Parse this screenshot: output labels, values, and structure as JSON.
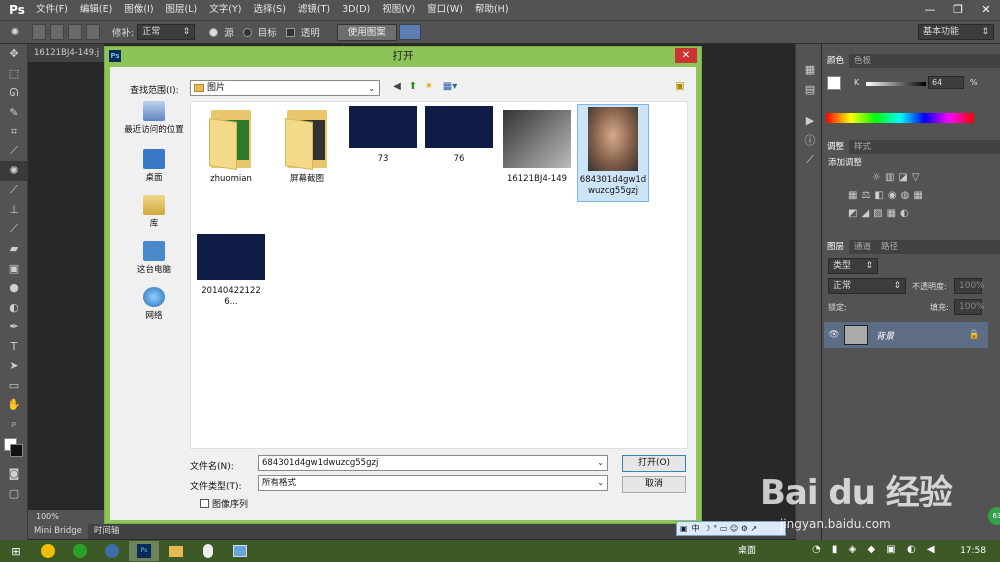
{
  "app": {
    "logo": "Ps"
  },
  "menubar": [
    "文件(F)",
    "编辑(E)",
    "图像(I)",
    "图层(L)",
    "文字(Y)",
    "选择(S)",
    "滤镜(T)",
    "3D(D)",
    "视图(V)",
    "窗口(W)",
    "帮助(H)"
  ],
  "options": {
    "feather_label": "修补:",
    "mode_value": "正常",
    "source_label": "源",
    "target_label": "目标",
    "transparent_label": "透明",
    "use_pattern_label": "使用图案",
    "workspace_value": "基本功能"
  },
  "document": {
    "tab_title": "16121BJ4-149.j",
    "zoom": "100%"
  },
  "bottom_tabs": [
    "Mini Bridge",
    "时间轴"
  ],
  "right_panel": {
    "color_tabs": [
      "颜色",
      "色板"
    ],
    "k_label": "K",
    "k_value": "64",
    "k_unit": "%",
    "adjust_tabs": [
      "调整",
      "样式"
    ],
    "add_adjustment": "添加调整",
    "layer_tabs": [
      "图层",
      "通道",
      "路径"
    ],
    "kind_label": "类型",
    "blend_mode": "正常",
    "opacity_label": "不透明度:",
    "opacity_value": "100%",
    "lock_label": "锁定:",
    "fill_label": "填充:",
    "fill_value": "100%",
    "layer_name": "背景"
  },
  "dialog": {
    "title": "打开",
    "look_in_label": "查找范围(I):",
    "look_in_value": "图片",
    "places": [
      "最近访问的位置",
      "桌面",
      "库",
      "这台电脑",
      "网络"
    ],
    "files": [
      {
        "name": "zhuomian",
        "kind": "folder"
      },
      {
        "name": "屏幕截图",
        "kind": "folder"
      },
      {
        "name": "73",
        "kind": "image"
      },
      {
        "name": "76",
        "kind": "image"
      },
      {
        "name": "16121BJ4-149",
        "kind": "image"
      },
      {
        "name": "684301d4gw1dwuzcg55gzj",
        "kind": "image",
        "selected": true
      },
      {
        "name": "201404221226...",
        "kind": "image"
      }
    ],
    "filename_label": "文件名(N):",
    "filename_value": "684301d4gw1dwuzcg55gzj",
    "filetype_label": "文件类型(T):",
    "filetype_value": "所有格式",
    "open_button": "打开(O)",
    "cancel_button": "取消",
    "image_sequence_label": "图像序列"
  },
  "taskbar": {
    "desktop_label": "桌面",
    "clock": "17:58"
  },
  "ime": {
    "label": "中"
  },
  "watermark": {
    "main": "Bai du 经验",
    "sub": "jingyan.baidu.com",
    "badge": "63"
  },
  "colors": {
    "dialog_frame": "#8dc458",
    "ps_dark": "#535353",
    "selection": "#cce4f7",
    "close_red": "#cc3333"
  }
}
